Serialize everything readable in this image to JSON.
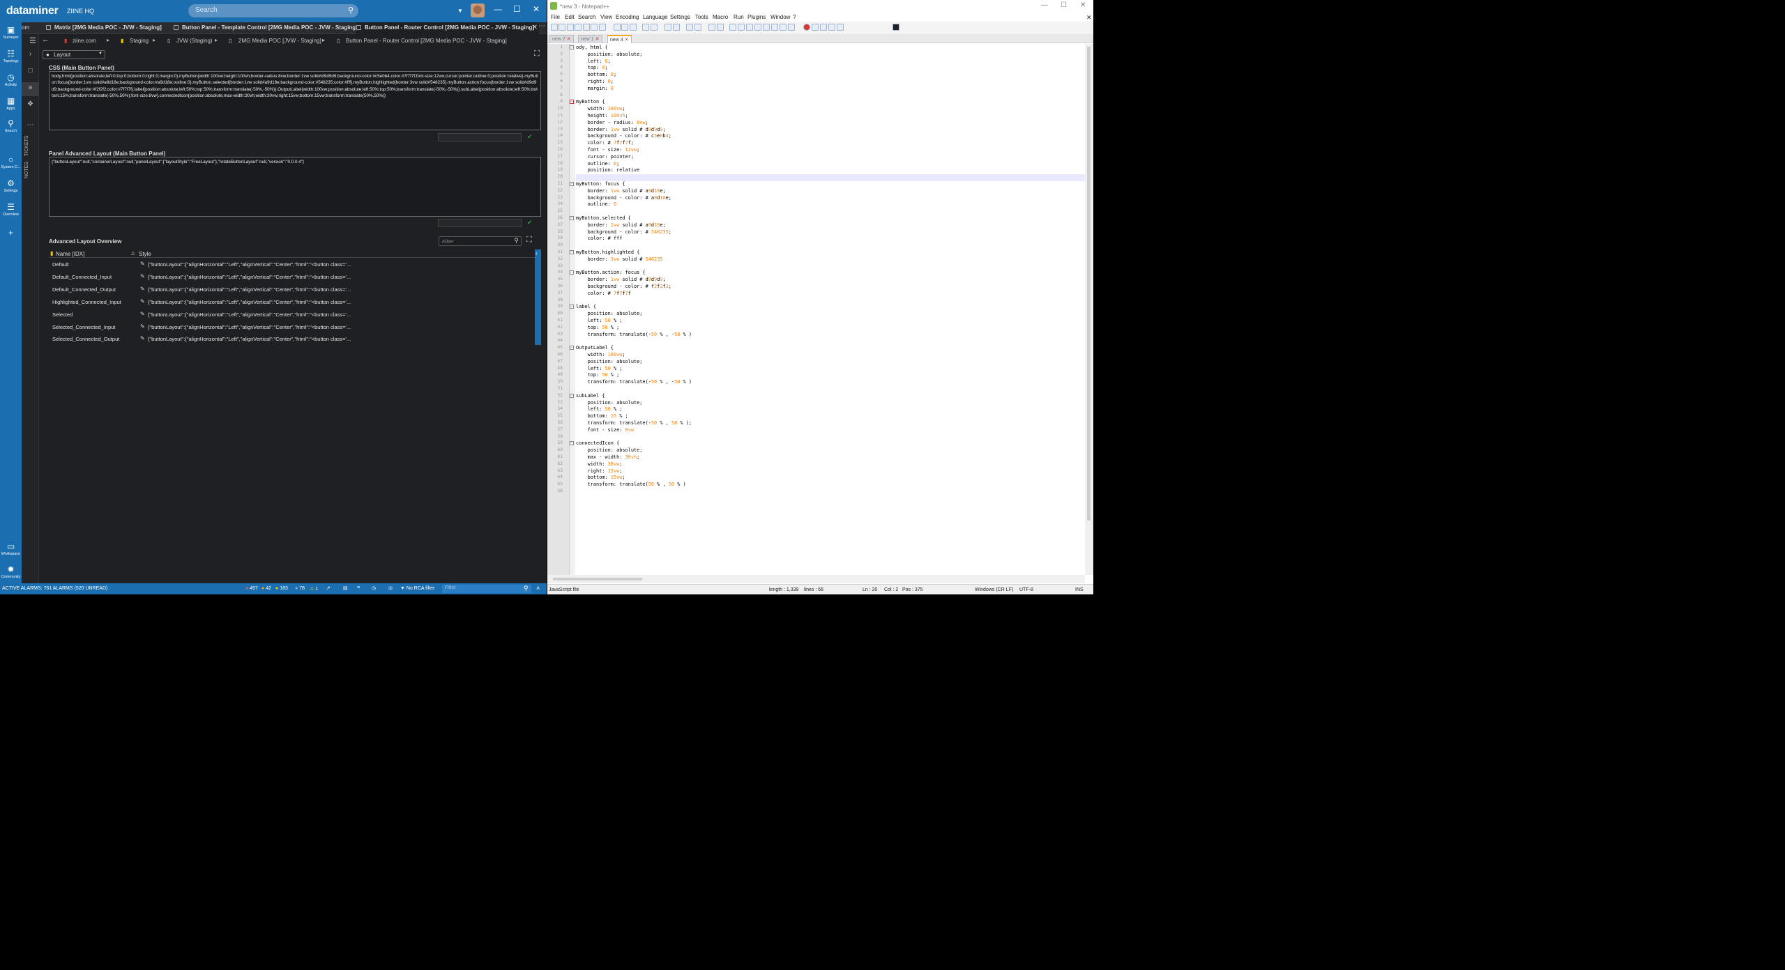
{
  "dataminer": {
    "logo": "dataminer",
    "org": "ZIINE HQ",
    "search_placeholder": "Search",
    "nav": [
      {
        "label": "Surveyor",
        "icon": "surveyor-icon"
      },
      {
        "label": "Topology",
        "icon": "topology-icon"
      },
      {
        "label": "Activity",
        "icon": "activity-icon"
      },
      {
        "label": "Apps",
        "icon": "apps-icon"
      },
      {
        "label": "Search",
        "icon": "search-icon"
      },
      {
        "label": "System C...",
        "icon": "globe-icon"
      },
      {
        "label": "Settings",
        "icon": "gear-icon"
      },
      {
        "label": "Overview",
        "icon": "overview-icon"
      },
      {
        "label": "Workspace",
        "icon": "workspace-icon"
      },
      {
        "label": "Community",
        "icon": "community-icon"
      }
    ],
    "vertical_tabs": [
      "TICKETS",
      "NOTES"
    ],
    "tabs": [
      {
        "label": "om"
      },
      {
        "label": "Matrix [2MG Media POC - JVW - Staging]"
      },
      {
        "label": "Button Panel - Template Control [2MG Media POC - JVW - Staging]"
      },
      {
        "label": "Button Panel - Router Control [2MG Media POC - JVW - Staging]"
      }
    ],
    "breadcrumbs": [
      "ziine.com",
      "Staging",
      "JVW (Staging)",
      "2MG Media POC [JVW - Staging]",
      "Button Panel - Router Control [2MG Media POC - JVW - Staging]"
    ],
    "layout_select": "Layout",
    "css_title": "CSS (Main Button Panel)",
    "css_value": "body,html{position:absolute;left:0;top:0;bottom:0;right:0;margin:0}.myButton{width:100vw;height:100vh;border-radius:8vw;border:1vw solid#d9d9d9;background-color:#c5e0b4;color:#7f7f7f;font-size:12vw;cursor:pointer;outline:0;position:relative}.myButton:focus{border:1vw solid#a9d18e;background-color:#a9d18e;outline:0}.myButton.selected{border:1vw solid#a9d18e;background-color:#548235;color:#fff}.myButton.highlighted{border:3vw solid#548235}.myButton.action:focus{border:1vw solid#d9d9d9;background-color:#f2f2f2;color:#7f7f7f}.label{position:absolute;left:50%;top:50%;transform:translate(-50%,-50%)}.OutputLabel{width:100vw;position:absolute;left:50%;top:50%;transform:translate(-50%,-50%)}.subLabel{position:absolute;left:50%;bottom:15%;transform:translate(-50%,50%);font-size:8vw}.connectedIcon{position:absolute;max-width:30vh;width:30vw;right:15vw;bottom:15vw;transform:translate(50%,50%)}",
    "panel_title": "Panel Advanced Layout (Main Button Panel)",
    "panel_value": "{\"buttonLayout\":null,\"containerLayout\":null,\"panelLayout\":{\"layoutStyle\":\"FreeLayout\"},\"rotateButtonLayout\":null,\"version\":\"0.0.0.4\"}",
    "overview_title": "Advanced Layout Overview",
    "filter_placeholder": "Filter",
    "columns": {
      "name": "Name [IDX]",
      "style": "Style"
    },
    "rows": [
      {
        "name": "Default",
        "style": "{\"buttonLayout\":{\"alignHorizontal\":\"Left\",\"alignVertical\":\"Center\",\"html\":\"<button class='..."
      },
      {
        "name": "Default_Connected_Input",
        "style": "{\"buttonLayout\":{\"alignHorizontal\":\"Left\",\"alignVertical\":\"Center\",\"html\":\"<button class='..."
      },
      {
        "name": "Default_Connected_Output",
        "style": "{\"buttonLayout\":{\"alignHorizontal\":\"Left\",\"alignVertical\":\"Center\",\"html\":\"<button class='..."
      },
      {
        "name": "Highlighted_Connected_Input",
        "style": "{\"buttonLayout\":{\"alignHorizontal\":\"Left\",\"alignVertical\":\"Center\",\"html\":\"<button class='..."
      },
      {
        "name": "Selected",
        "style": "{\"buttonLayout\":{\"alignHorizontal\":\"Left\",\"alignVertical\":\"Center\",\"html\":\"<button class='..."
      },
      {
        "name": "Selected_Connected_Input",
        "style": "{\"buttonLayout\":{\"alignHorizontal\":\"Left\",\"alignVertical\":\"Center\",\"html\":\"<button class='..."
      },
      {
        "name": "Selected_Connected_Output",
        "style": "{\"buttonLayout\":{\"alignHorizontal\":\"Left\",\"alignVertical\":\"Center\",\"html\":\"<button class='..."
      }
    ],
    "status": {
      "alarms": "ACTIVE ALARMS: 761 ALARMS (520 UNREAD)",
      "c1": "457",
      "c2": "42",
      "c3": "183",
      "c4": "78",
      "c5": "1",
      "rca": "No RCA filter",
      "filter_placeholder": "Filter"
    },
    "colors": {
      "brand": "#1b6fb0",
      "bg": "#1f2023",
      "ok": "#2fa043"
    }
  },
  "notepad": {
    "title": "*new 3 - Notepad++",
    "menu": [
      "File",
      "Edit",
      "Search",
      "View",
      "Encoding",
      "Language",
      "Settings",
      "Tools",
      "Macro",
      "Run",
      "Plugins",
      "Window",
      "?"
    ],
    "doc_tabs": [
      "new 2",
      "new 1",
      "new 3"
    ],
    "lines": [
      "ody, html {",
      "    position: absolute;",
      "    left: 0;",
      "    top: 0;",
      "    bottom: 0;",
      "    right: 0;",
      "    margin: 0",
      "",
      "myButton {",
      "    width: 100vw;",
      "    height: 100vh;",
      "    border - radius: 8vw;",
      "    border: 1vw solid # d9d9d9;",
      "    background - color: # c5e0b4;",
      "    color: # 7f7f7f;",
      "    font - size: 12vw;",
      "    cursor: pointer;",
      "    outline: 0;",
      "    position: relative",
      "",
      "myButton: focus {",
      "    border: 1vw solid # a9d18e;",
      "    background - color: # a9d18e;",
      "    outline: 0",
      "",
      "myButton.selected {",
      "    border: 1vw solid # a9d18e;",
      "    background - color: # 548235;",
      "    color: # fff",
      "",
      "myButton.highlighted {",
      "    border: 3vw solid # 548235",
      "",
      "myButton.action: focus {",
      "    border: 1vw solid # d9d9d9;",
      "    background - color: # f2f2f2;",
      "    color: # 7f7f7f",
      "",
      "label {",
      "    position: absolute;",
      "    left: 50 % ;",
      "    top: 50 % ;",
      "    transform: translate(-50 % , -50 % )",
      "",
      "OutputLabel {",
      "    width: 100vw;",
      "    position: absolute;",
      "    left: 50 % ;",
      "    top: 50 % ;",
      "    transform: translate(-50 % , -50 % )",
      "",
      "subLabel {",
      "    position: absolute;",
      "    left: 50 % ;",
      "    bottom: 15 % ;",
      "    transform: translate(-50 % , 50 % );",
      "    font - size: 8vw",
      "",
      "connectedIcon {",
      "    position: absolute;",
      "    max - width: 30vh;",
      "    width: 30vw;",
      "    right: 15vw;",
      "    bottom: 15vw;",
      "    transform: translate(50 % , 50 % )",
      ""
    ],
    "current_line": 20,
    "status": {
      "type": "JavaScript file",
      "length": "length : 1,339",
      "lines": "lines : 66",
      "ln": "Ln : 20",
      "col": "Col : 2",
      "pos": "Pos : 375",
      "eol": "Windows (CR LF)",
      "enc": "UTF-8",
      "ins": "INS"
    }
  }
}
